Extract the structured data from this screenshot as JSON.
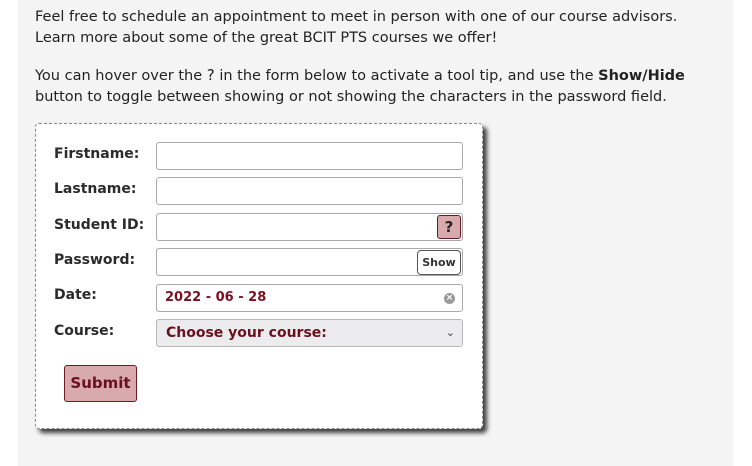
{
  "intro": {
    "paragraph1": "Feel free to schedule an appointment to meet in person with one of our course advisors. Learn more about some of the great BCIT PTS courses we offer!",
    "paragraph2_part1": "You can hover over the",
    "paragraph2_icon": "?",
    "paragraph2_part2": "in the form below to activate a tool tip, and use the",
    "paragraph2_bold": "Show/Hide",
    "paragraph2_part3": "button to toggle between showing or not showing the characters in the password field."
  },
  "form": {
    "firstname_label": "Firstname:",
    "firstname_value": "",
    "lastname_label": "Lastname:",
    "lastname_value": "",
    "studentid_label": "Student ID:",
    "studentid_value": "",
    "help_label": "?",
    "password_label": "Password:",
    "password_value": "",
    "show_label": "Show",
    "date_label": "Date:",
    "date_value": "2022 - 06 - 28",
    "course_label": "Course:",
    "course_value": "Choose your course:",
    "submit_label": "Submit"
  },
  "icons": {
    "help": "question-icon",
    "clear": "clear-icon",
    "dropdown": "chevron-down-icon"
  },
  "colors": {
    "accent": "#d8a9ad",
    "accent_border": "#6b1b22",
    "accent_text": "#6b1020"
  }
}
